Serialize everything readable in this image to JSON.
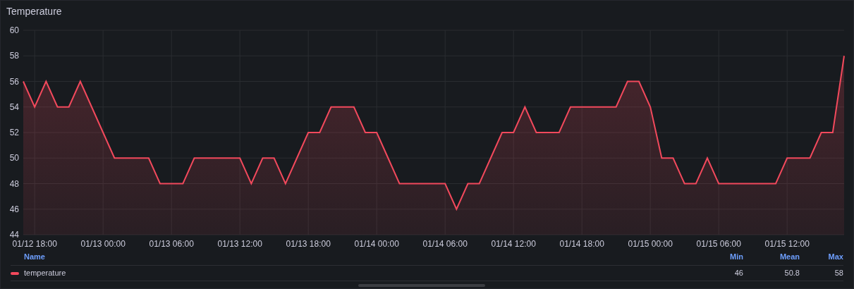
{
  "panel": {
    "title": "Temperature"
  },
  "chart_data": {
    "type": "area",
    "xlabel": null,
    "ylabel": null,
    "categories": [
      null,
      "01/12 18:00",
      null,
      null,
      null,
      null,
      null,
      "01/13 00:00",
      null,
      null,
      null,
      null,
      null,
      "01/13 06:00",
      null,
      null,
      null,
      null,
      null,
      "01/13 12:00",
      null,
      null,
      null,
      null,
      null,
      "01/13 18:00",
      null,
      null,
      null,
      null,
      null,
      "01/14 00:00",
      null,
      null,
      null,
      null,
      null,
      "01/14 06:00",
      null,
      null,
      null,
      null,
      null,
      "01/14 12:00",
      null,
      null,
      null,
      null,
      null,
      "01/14 18:00",
      null,
      null,
      null,
      null,
      null,
      "01/15 00:00",
      null,
      null,
      null,
      null,
      null,
      "01/15 06:00",
      null,
      null,
      null,
      null,
      null,
      "01/15 12:00",
      null,
      null,
      null,
      null,
      null
    ],
    "series": [
      {
        "name": "temperature",
        "color": "#f2495c",
        "values": [
          56,
          54,
          56,
          54,
          54,
          56,
          54,
          52,
          50,
          50,
          50,
          50,
          48,
          48,
          48,
          50,
          50,
          50,
          50,
          50,
          48,
          50,
          50,
          48,
          50,
          52,
          52,
          54,
          54,
          54,
          52,
          52,
          50,
          48,
          48,
          48,
          48,
          48,
          46,
          48,
          48,
          50,
          52,
          52,
          54,
          52,
          52,
          52,
          54,
          54,
          54,
          54,
          54,
          56,
          56,
          54,
          50,
          50,
          48,
          48,
          50,
          48,
          48,
          48,
          48,
          48,
          48,
          50,
          50,
          50,
          52,
          52,
          58
        ]
      }
    ],
    "ylim": [
      44,
      60
    ],
    "grid": true,
    "yticks": [
      44,
      46,
      48,
      50,
      52,
      54,
      56,
      58,
      60
    ]
  },
  "legend": {
    "columns": [
      "Name",
      "Min",
      "Mean",
      "Max"
    ],
    "rows": [
      {
        "min": "46",
        "mean": "50.8",
        "max": "58"
      }
    ]
  }
}
